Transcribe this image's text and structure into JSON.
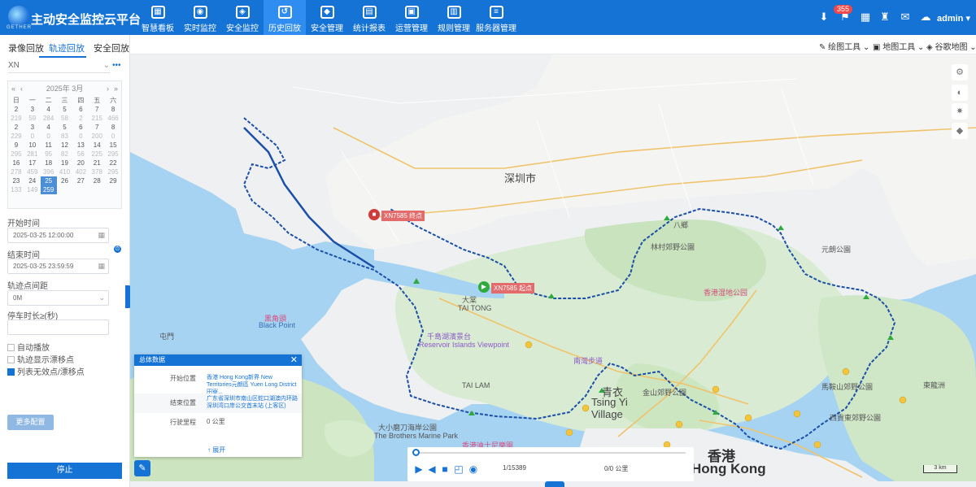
{
  "header": {
    "logo_sub": "GETHER",
    "title": "主动安全监控云平台",
    "nav": [
      {
        "label": "智慧看板",
        "glyph": "▦"
      },
      {
        "label": "实时监控",
        "glyph": "◉"
      },
      {
        "label": "安全监控",
        "glyph": "◈"
      },
      {
        "label": "历史回放",
        "glyph": "↺"
      },
      {
        "label": "安全管理",
        "glyph": "◆"
      },
      {
        "label": "统计报表",
        "glyph": "▤"
      },
      {
        "label": "运营管理",
        "glyph": "▣"
      },
      {
        "label": "规则管理",
        "glyph": "▥"
      },
      {
        "label": "服务器管理",
        "glyph": "≡"
      }
    ],
    "active_nav": "历史回放",
    "notification_count": "355",
    "user": "admin",
    "icons": [
      "download-icon",
      "alarm-icon",
      "grid-icon",
      "shirt-icon",
      "mail-icon",
      "cloud-icon"
    ]
  },
  "sidebar": {
    "tabs": [
      "录像回放",
      "轨迹回放",
      "安全回放"
    ],
    "active_tab": "轨迹回放",
    "vehicle": "XN",
    "calendar": {
      "title": "2025年  3月",
      "weekdays": [
        "日",
        "一",
        "二",
        "三",
        "四",
        "五",
        "六"
      ],
      "rows": [
        [
          "2",
          "3",
          "4",
          "5",
          "6",
          "7",
          "8"
        ],
        [
          "219",
          "59",
          "284",
          "58",
          "2",
          "215",
          "466"
        ],
        [
          "2",
          "3",
          "4",
          "5",
          "6",
          "7",
          "8"
        ],
        [
          "229",
          "0",
          "0",
          "83",
          "0",
          "200",
          "0"
        ],
        [
          "9",
          "10",
          "11",
          "12",
          "13",
          "14",
          "15"
        ],
        [
          "295",
          "281",
          "95",
          "82",
          "56",
          "225",
          "295"
        ],
        [
          "16",
          "17",
          "18",
          "19",
          "20",
          "21",
          "22"
        ],
        [
          "278",
          "459",
          "396",
          "410",
          "402",
          "378",
          "295"
        ],
        [
          "23",
          "24",
          "25",
          "26",
          "27",
          "28",
          "29"
        ],
        [
          "133",
          "149",
          "259",
          "",
          "",
          "",
          ""
        ]
      ],
      "selected_day": "25"
    },
    "start_time_label": "开始时间",
    "start_time": "2025-03-25 12:00:00",
    "end_time_label": "结束时间",
    "end_time": "2025-03-25 23:59:59",
    "point_interval_label": "轨迹点间距",
    "point_interval": "0M",
    "stop_label": "停车时长≥(秒)",
    "auto_play": "自动播放",
    "show_drift": "轨迹显示漂移点",
    "list_invalid": "列表无效点/漂移点",
    "more_config": "更多配置",
    "stop_button": "停止"
  },
  "maptools": {
    "draw": "绘图工具",
    "map": "地图工具",
    "provider": "谷歌地图"
  },
  "map": {
    "labels": {
      "shenzhen": "深圳市",
      "hongkong_cn": "香港",
      "hongkong_en": "Hong Kong",
      "tsing_yi": "青衣",
      "tsing_yi_en": "Tsing Yi",
      "tsing_yi_village": "Village",
      "tai_tong": "大棠",
      "tai_tong_en": "TAI TONG",
      "reservoir": "千島湖濱景台",
      "reservoir_en": "Reservoir Islands Viewpoint",
      "brothers": "大小磨刀海岸公園",
      "brothers_en": "The Brothers Marine Park",
      "disney": "香港迪士尼樂園",
      "nan_tong": "南灣步道",
      "hk_wetland": "香港湿地公园",
      "pat_heung": "八鄉",
      "lam_tsuen": "林村郊野公園",
      "tai_lam": "TAI LAM",
      "kam_shan": "金山郊野公園",
      "ma_on_shan": "馬鞍山郊野公園",
      "sai_kung": "西貢東郊野公園",
      "tuen_mun": "屯門",
      "black_point": "黑角頭",
      "black_point_en": "Black Point",
      "tung_lung": "東龍洲",
      "yuen_long_park": "元朗公園",
      "start_tag": "XN7585 起点",
      "end_tag": "XN7585 终点",
      "scale": "3 km"
    },
    "route_color": "#1b4fa8"
  },
  "info_panel": {
    "title": "总体数据",
    "start_label": "开始位置",
    "start_value": "香港 Hong Kong新界 New Territories元朗區 Yuen Long District田寮...",
    "end_label": "结束位置",
    "end_value": "广东省深圳市南山区蛇口湖澳内环路深圳湾口岸公交首末站 (上客区)",
    "mileage_label": "行驶里程",
    "mileage_value": "0 公里",
    "expand": "展开"
  },
  "player": {
    "progress": 0.0,
    "position": "1/15389",
    "distance": "0/0 公里"
  }
}
